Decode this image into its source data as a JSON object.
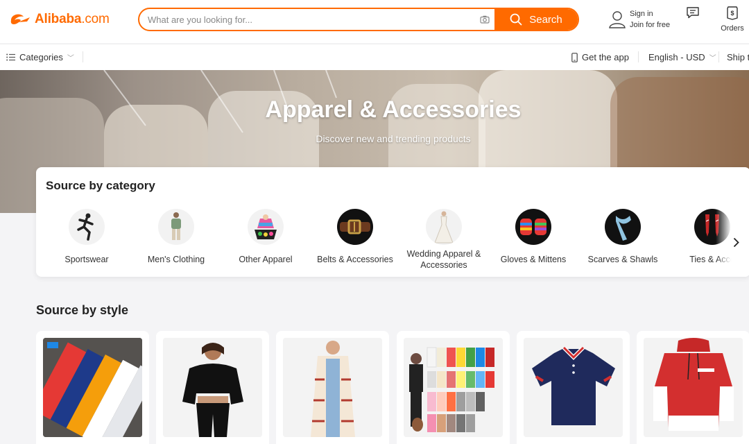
{
  "brand": {
    "name": "Alibaba",
    "suffix": ".com",
    "color": "#ff6a00"
  },
  "search": {
    "placeholder": "What are you looking for...",
    "button_label": "Search"
  },
  "account": {
    "sign_in": "Sign in",
    "join": "Join for free"
  },
  "orders_label": "Orders",
  "subnav": {
    "categories_label": "Categories",
    "get_app": "Get the app",
    "language": "English - USD",
    "ship_to": "Ship t"
  },
  "hero": {
    "title": "Apparel & Accessories",
    "subtitle": "Discover new and trending products"
  },
  "category_section": {
    "title": "Source by category",
    "items": [
      {
        "label": "Sportswear",
        "icon": "sportswear-icon"
      },
      {
        "label": "Men's Clothing",
        "icon": "mens-clothing-icon"
      },
      {
        "label": "Other Apparel",
        "icon": "other-apparel-icon"
      },
      {
        "label": "Belts & Accessories",
        "icon": "belt-icon"
      },
      {
        "label": "Wedding Apparel & Accessories",
        "icon": "wedding-dress-icon"
      },
      {
        "label": "Gloves & Mittens",
        "icon": "gloves-icon"
      },
      {
        "label": "Scarves & Shawls",
        "icon": "scarf-icon"
      },
      {
        "label": "Ties & Acce",
        "icon": "tie-icon"
      }
    ]
  },
  "style_section": {
    "title": "Source by style",
    "items": [
      {
        "image": "colorful-tshirts-stack"
      },
      {
        "image": "black-crop-sweatshirt-set"
      },
      {
        "image": "patterned-long-cardigan"
      },
      {
        "image": "kids-hoodie-set-colors"
      },
      {
        "image": "navy-polo-shirt"
      },
      {
        "image": "red-hooded-sweatshirt"
      }
    ]
  }
}
